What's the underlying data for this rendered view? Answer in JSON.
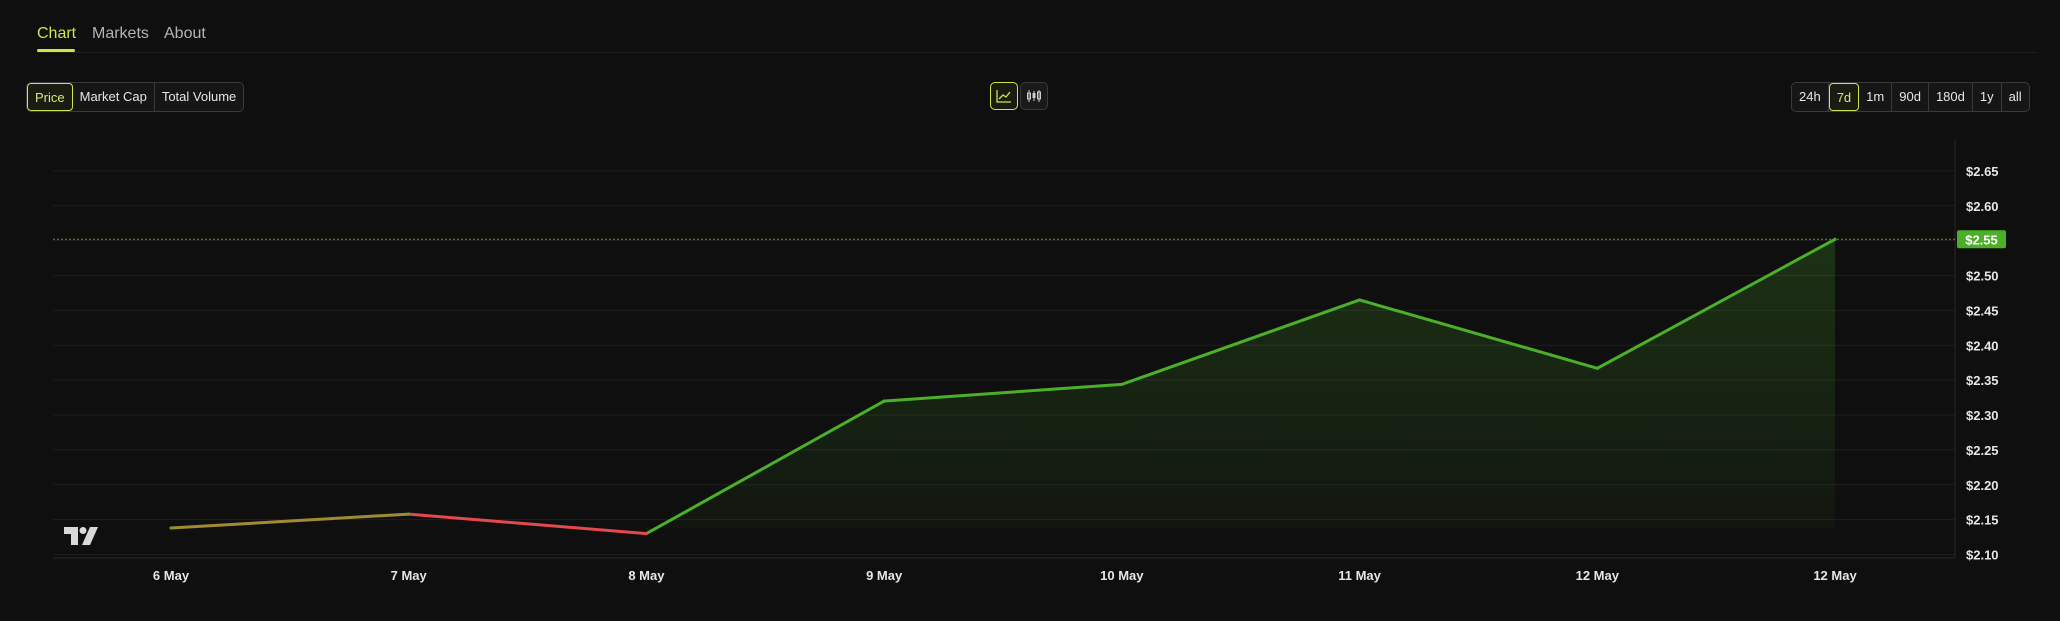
{
  "tabs": [
    {
      "label": "Chart",
      "active": true
    },
    {
      "label": "Markets",
      "active": false
    },
    {
      "label": "About",
      "active": false
    }
  ],
  "metric_buttons": [
    {
      "label": "Price",
      "active": true
    },
    {
      "label": "Market Cap",
      "active": false
    },
    {
      "label": "Total Volume",
      "active": false
    }
  ],
  "chart_type_buttons": [
    {
      "icon": "line-chart-icon",
      "active": true
    },
    {
      "icon": "candlestick-icon",
      "active": false
    }
  ],
  "range_buttons": [
    {
      "label": "24h",
      "active": false
    },
    {
      "label": "7d",
      "active": true
    },
    {
      "label": "1m",
      "active": false
    },
    {
      "label": "90d",
      "active": false
    },
    {
      "label": "180d",
      "active": false
    },
    {
      "label": "1y",
      "active": false
    },
    {
      "label": "all",
      "active": false
    }
  ],
  "colors": {
    "accent": "#c6e84a",
    "up_line": "#4caf28",
    "down_line": "#e5484d",
    "price_tag_bg": "#4caf28"
  },
  "chart_data": {
    "type": "line",
    "x": [
      "6 May",
      "7 May",
      "8 May",
      "9 May",
      "10 May",
      "11 May",
      "12 May",
      "12 May"
    ],
    "values": [
      2.138,
      2.158,
      2.13,
      2.32,
      2.344,
      2.465,
      2.367,
      2.552
    ],
    "ylim": [
      2.085,
      2.68
    ],
    "yticks": [
      "$2.10",
      "$2.15",
      "$2.20",
      "$2.25",
      "$2.30",
      "$2.35",
      "$2.40",
      "$2.45",
      "$2.50",
      "$2.55",
      "$2.60",
      "$2.65"
    ],
    "ytick_values": [
      2.1,
      2.15,
      2.2,
      2.25,
      2.3,
      2.35,
      2.4,
      2.45,
      2.5,
      2.55,
      2.6,
      2.65
    ],
    "current_price_label": "$2.55",
    "current_price": 2.552,
    "grid": true,
    "area_fill": true
  }
}
